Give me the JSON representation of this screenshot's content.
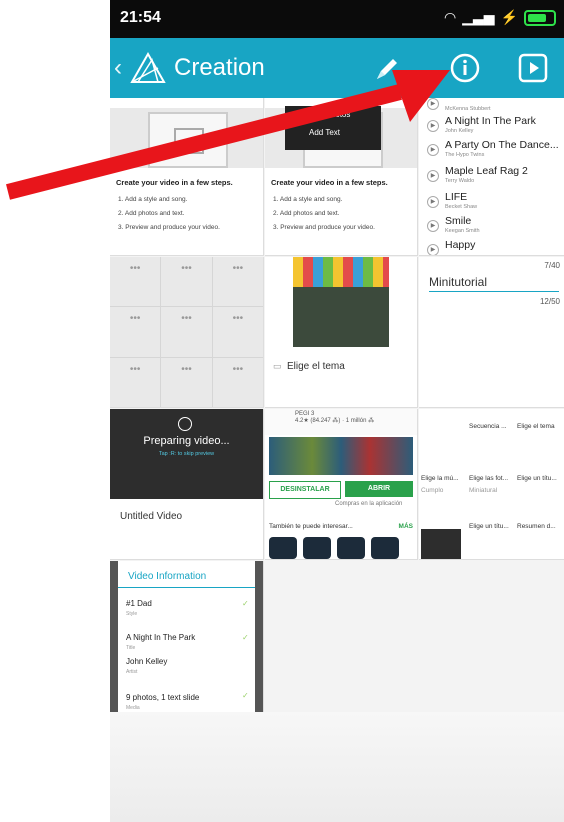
{
  "status": {
    "time": "21:54"
  },
  "appbar": {
    "back": "‹",
    "title": "Creation"
  },
  "colors": {
    "accent": "#18a5c4",
    "arrow": "#e8151b",
    "green": "#2aa14b"
  },
  "tile1": {
    "steps_title": "Create your video in a few steps.",
    "steps": [
      "1. Add a style and song.",
      "2. Add photos and text.",
      "3. Preview and produce your video."
    ]
  },
  "tile2": {
    "menu": [
      "Add Photos",
      "Add Text"
    ],
    "steps_title": "Create your video in a few steps.",
    "steps": [
      "1. Add a style and song.",
      "2. Add photos and text.",
      "3. Preview and produce your video."
    ]
  },
  "tile3": {
    "songs": [
      {
        "title": "",
        "artist": "McKenna Stubbert"
      },
      {
        "title": "A Night In The Park",
        "artist": "John Kelley"
      },
      {
        "title": "A Party On The Dance...",
        "artist": "The Hypo Twins"
      },
      {
        "title": "Maple Leaf Rag 2",
        "artist": "Terry Waldo"
      },
      {
        "title": "LIFE",
        "artist": "Becket Shaw"
      },
      {
        "title": "Smile",
        "artist": "Keegan Smith"
      },
      {
        "title": "Happy",
        "artist": ""
      }
    ]
  },
  "tile5": {
    "label": "Elige el tema"
  },
  "tile6": {
    "title": "Minitutorial",
    "count1": "7/40",
    "count2": "12/50"
  },
  "tile7": {
    "title": "Preparing video...",
    "subtitle": "Tap :R: to skip preview",
    "name": "Untitled Video"
  },
  "tile8": {
    "rating": "PEGI 3",
    "info": "4.2★ (84.247 ⁂) · 1 millón ⁂",
    "uninstall": "DESINSTALAR",
    "open": "ABRIR",
    "purchases": "Compras en la aplicación",
    "also": "También te puede interesar...",
    "more": "MÁS"
  },
  "tile9": {
    "row1": [
      "",
      "Secuencia ...",
      "Elige el tema"
    ],
    "row2": [
      "Elige la mú...",
      "Elige las fot...",
      "Elige un títu..."
    ],
    "row3": [
      "Cumplo",
      "Miniatural",
      ""
    ],
    "row4": [
      "",
      "Elige un títu...",
      "Resumen d..."
    ]
  },
  "tile10": {
    "title": "Video Information",
    "items": [
      {
        "value": "#1 Dad",
        "label": "Style"
      },
      {
        "value": "A Night In The Park",
        "label": "Title"
      },
      {
        "value": "John Kelley",
        "label": "Artist"
      },
      {
        "value": "9 photos, 1 text slide",
        "label": "Media"
      }
    ]
  }
}
